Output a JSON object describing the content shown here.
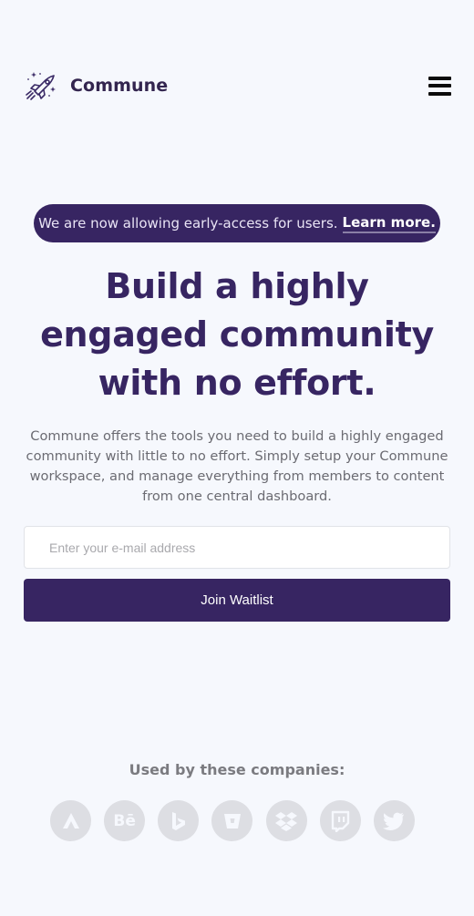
{
  "header": {
    "brand_name": "Commune",
    "logo_icon": "rocket-icon",
    "menu_icon": "hamburger-menu-icon"
  },
  "announcement": {
    "text": "We are now allowing early-access for users.",
    "link_label": "Learn more."
  },
  "hero": {
    "title": "Build a highly engaged community with no effort.",
    "subtitle": "Commune offers the tools you need to build a highly engaged community with little to no effort. Simply setup your Commune workspace, and manage everything from members to content from one central dashboard."
  },
  "form": {
    "email_placeholder": "Enter your e-mail address",
    "email_value": "",
    "submit_label": "Join Waitlist"
  },
  "companies": {
    "title": "Used by these companies:",
    "logos": [
      {
        "icon": "atlassian-icon"
      },
      {
        "icon": "behance-icon",
        "text": "Bē"
      },
      {
        "icon": "bing-icon"
      },
      {
        "icon": "bitbucket-icon"
      },
      {
        "icon": "dropbox-icon"
      },
      {
        "icon": "twitch-icon"
      },
      {
        "icon": "twitter-icon"
      }
    ]
  },
  "colors": {
    "background": "#f6f8fd",
    "brand_primary": "#372562",
    "text_muted": "#6b6b72",
    "logo_gray": "#dddee3"
  }
}
